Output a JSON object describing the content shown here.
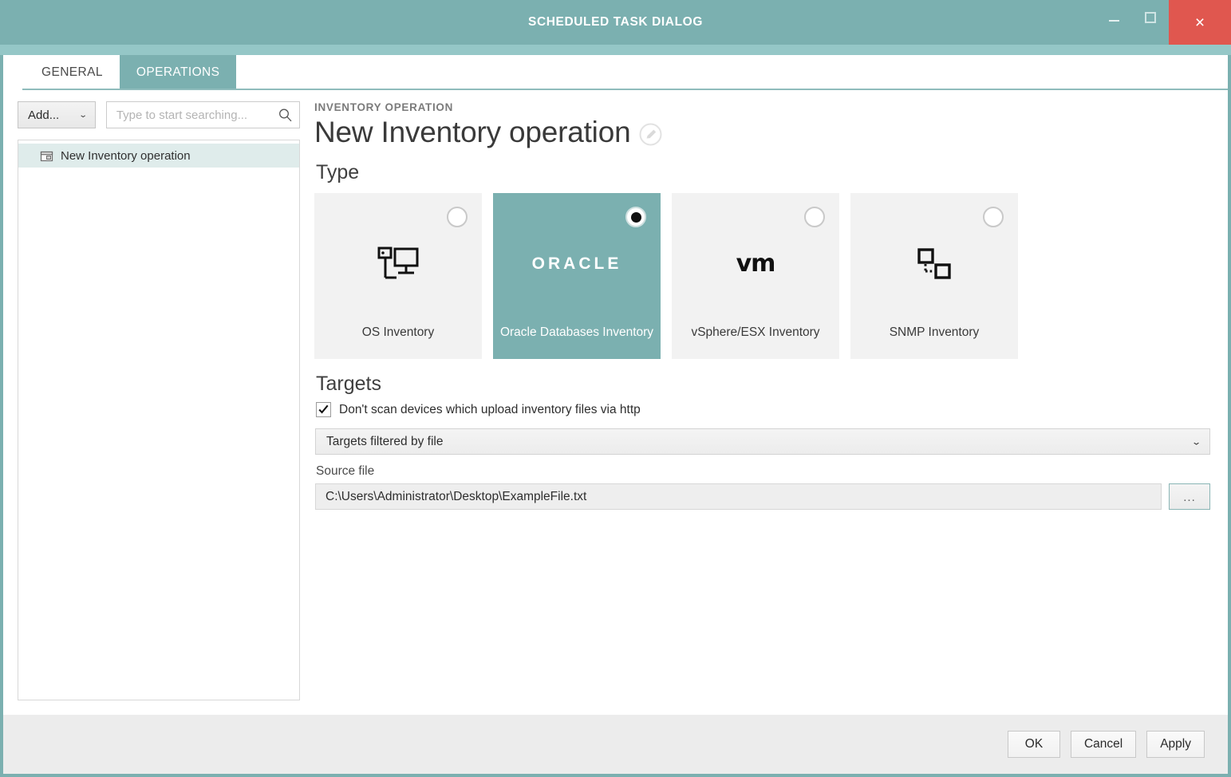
{
  "window": {
    "title": "Scheduled Task Dialog",
    "controls": {
      "minimize": "minimize-icon",
      "maximize": "maximize-icon",
      "close": "×"
    },
    "accent_color": "#7bb0b0",
    "close_color": "#e0574f"
  },
  "tabs": [
    {
      "label": "GENERAL",
      "active": false
    },
    {
      "label": "OPERATIONS",
      "active": true
    }
  ],
  "sidebar": {
    "add_button": {
      "label": "Add...",
      "caret": "⌄"
    },
    "search": {
      "placeholder": "Type to start searching...",
      "value": "",
      "icon": "search-icon"
    },
    "items": [
      {
        "label": "New Inventory operation",
        "icon": "box-icon",
        "selected": true
      }
    ]
  },
  "detail": {
    "eyebrow": "INVENTORY OPERATION",
    "title": "New Inventory operation",
    "edit_icon": "pencil-circle-icon",
    "type_heading": "Type",
    "type_cards": [
      {
        "label": "OS Inventory",
        "glyph": "os-inventory-icon",
        "selected": false
      },
      {
        "label": "Oracle Databases Inventory",
        "glyph": "oracle-logo",
        "glyph_text": "ORACLE",
        "selected": true
      },
      {
        "label": "vSphere/ESX Inventory",
        "glyph": "vmware-logo",
        "glyph_text": "vm",
        "selected": false
      },
      {
        "label": "SNMP Inventory",
        "glyph": "snmp-inventory-icon",
        "selected": false
      }
    ],
    "targets_heading": "Targets",
    "checkbox": {
      "label": "Don't scan devices which upload inventory files via http",
      "checked": true
    },
    "filter_select": {
      "value": "Targets filtered by file",
      "caret": "⌄"
    },
    "source_file": {
      "label": "Source file",
      "value": "C:\\Users\\Administrator\\Desktop\\ExampleFile.txt",
      "browse_label": "..."
    }
  },
  "footer": {
    "buttons": [
      {
        "label": "OK"
      },
      {
        "label": "Cancel"
      },
      {
        "label": "Apply"
      }
    ]
  }
}
